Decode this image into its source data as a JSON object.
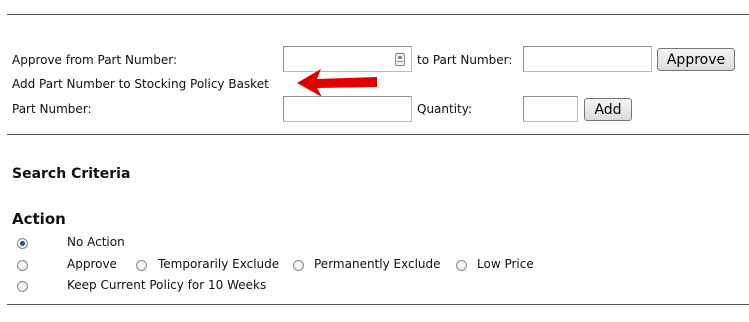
{
  "approve_row": {
    "from_label": "Approve from Part Number:",
    "from_value": "",
    "to_label": "to Part Number:",
    "to_value": "",
    "approve_button": "Approve"
  },
  "basket_label": "Add Part Number to Stocking Policy Basket",
  "add_row": {
    "part_label": "Part Number:",
    "part_value": "",
    "quantity_label": "Quantity:",
    "quantity_value": "",
    "add_button": "Add"
  },
  "search_criteria_title": "Search Criteria",
  "action": {
    "title": "Action",
    "options": [
      {
        "label": "No Action",
        "checked": true
      },
      {
        "label": "Approve",
        "checked": false
      },
      {
        "label": "Temporarily Exclude",
        "checked": false
      },
      {
        "label": "Permanently Exclude",
        "checked": false
      },
      {
        "label": "Low Price",
        "checked": false
      },
      {
        "label": "Keep Current Policy for 10 Weeks",
        "checked": false
      }
    ]
  },
  "colors": {
    "annotation_arrow": "#e00000",
    "radio_selected": "#2a4f86"
  }
}
